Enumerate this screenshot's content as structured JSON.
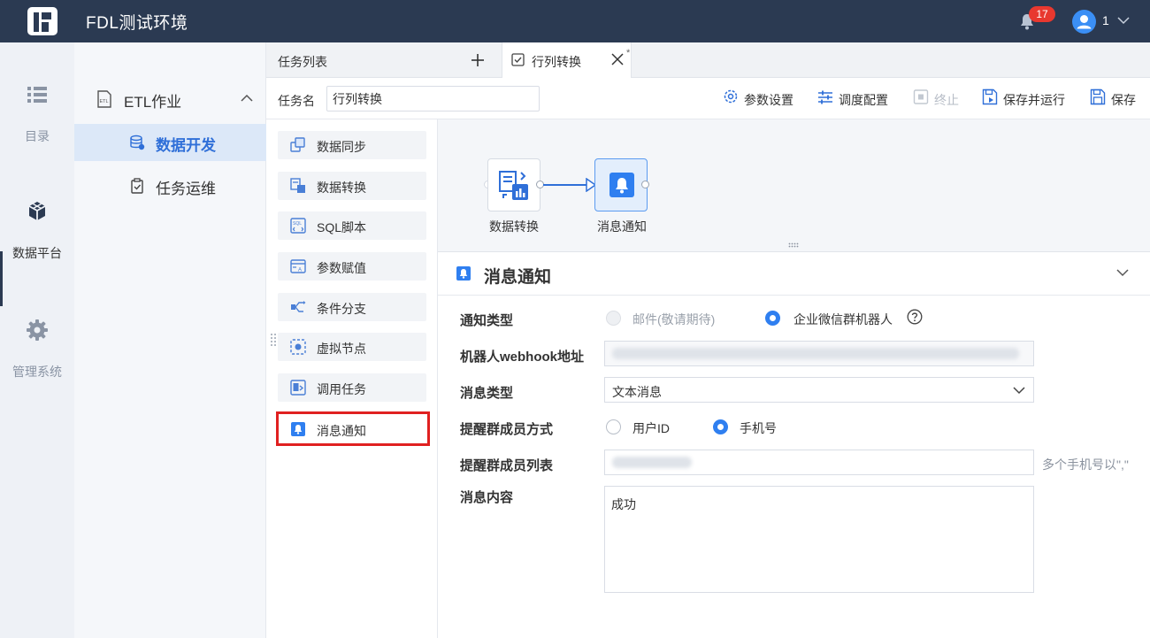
{
  "app": {
    "title": "FDL测试环境",
    "notification_count": "17",
    "user_name": "1"
  },
  "rail": {
    "items": [
      {
        "label": "目录",
        "icon": "list-icon"
      },
      {
        "label": "数据平台",
        "icon": "cube-icon",
        "active": true
      },
      {
        "label": "管理系统",
        "icon": "gear-icon"
      }
    ]
  },
  "submenu": {
    "group_label": "ETL作业",
    "items": [
      {
        "label": "数据开发",
        "icon": "database-icon",
        "active": true
      },
      {
        "label": "任务运维",
        "icon": "clipboard-icon"
      }
    ]
  },
  "tabs": {
    "list_label": "任务列表",
    "active_label": "行列转换",
    "unsaved_mark": "*"
  },
  "taskbar": {
    "name_label": "任务名",
    "name_value": "行列转换",
    "tools": [
      "参数设置",
      "调度配置",
      "终止",
      "保存并运行",
      "保存"
    ]
  },
  "palette": {
    "items": [
      "数据同步",
      "数据转换",
      "SQL脚本",
      "参数赋值",
      "条件分支",
      "虚拟节点",
      "调用任务",
      "消息通知"
    ]
  },
  "canvas": {
    "nodes": [
      {
        "label": "数据转换",
        "icon": "data-transform-icon"
      },
      {
        "label": "消息通知",
        "icon": "bell-icon",
        "selected": true
      }
    ]
  },
  "props": {
    "title": "消息通知",
    "notify_type_label": "通知类型",
    "notify_type_options": [
      "邮件(敬请期待)",
      "企业微信群机器人"
    ],
    "notify_type_selected": "企业微信群机器人",
    "webhook_label": "机器人webhook地址",
    "msg_type_label": "消息类型",
    "msg_type_value": "文本消息",
    "remind_mode_label": "提醒群成员方式",
    "remind_mode_options": [
      "用户ID",
      "手机号"
    ],
    "remind_mode_selected": "手机号",
    "remind_list_label": "提醒群成员列表",
    "remind_list_hint": "多个手机号以\",\"",
    "content_label": "消息内容",
    "content_value": "成功"
  },
  "colors": {
    "topbar": "#2b3a52",
    "accent": "#2f7ff0",
    "badge": "#e8382f",
    "highlight_box": "#e02020"
  }
}
